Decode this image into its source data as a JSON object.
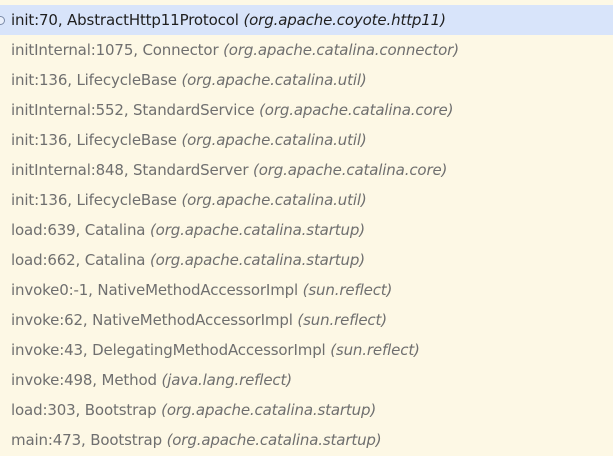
{
  "frames": [
    {
      "method": "init:70, AbstractHttp11Protocol",
      "pkg": "(org.apache.coyote.http11)"
    },
    {
      "method": "initInternal:1075, Connector",
      "pkg": "(org.apache.catalina.connector)"
    },
    {
      "method": "init:136, LifecycleBase",
      "pkg": "(org.apache.catalina.util)"
    },
    {
      "method": "initInternal:552, StandardService",
      "pkg": "(org.apache.catalina.core)"
    },
    {
      "method": "init:136, LifecycleBase",
      "pkg": "(org.apache.catalina.util)"
    },
    {
      "method": "initInternal:848, StandardServer",
      "pkg": "(org.apache.catalina.core)"
    },
    {
      "method": "init:136, LifecycleBase",
      "pkg": "(org.apache.catalina.util)"
    },
    {
      "method": "load:639, Catalina",
      "pkg": "(org.apache.catalina.startup)"
    },
    {
      "method": "load:662, Catalina",
      "pkg": "(org.apache.catalina.startup)"
    },
    {
      "method": "invoke0:-1, NativeMethodAccessorImpl",
      "pkg": "(sun.reflect)"
    },
    {
      "method": "invoke:62, NativeMethodAccessorImpl",
      "pkg": "(sun.reflect)"
    },
    {
      "method": "invoke:43, DelegatingMethodAccessorImpl",
      "pkg": "(sun.reflect)"
    },
    {
      "method": "invoke:498, Method",
      "pkg": "(java.lang.reflect)"
    },
    {
      "method": "load:303, Bootstrap",
      "pkg": "(org.apache.catalina.startup)"
    },
    {
      "method": "main:473, Bootstrap",
      "pkg": "(org.apache.catalina.startup)"
    }
  ],
  "colors": {
    "panel_background": "#fdf8e5",
    "selected_background": "#d8e4fa",
    "selected_text": "#1f1f1f",
    "frame_text": "#6f6f6f"
  },
  "selected_index": 0,
  "icons": {
    "current_frame": "current-frame-icon"
  }
}
